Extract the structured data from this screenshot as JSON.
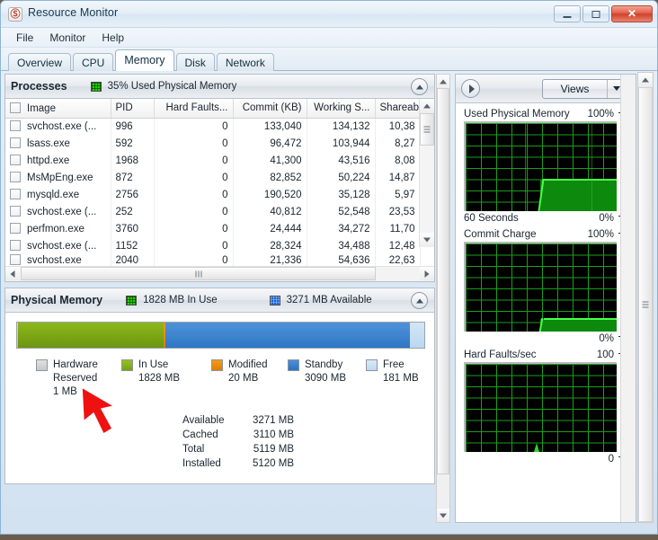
{
  "window": {
    "title": "Resource Monitor",
    "icon": "app-icon",
    "minimize_label": "",
    "maximize_label": "",
    "close_label": "✕"
  },
  "menu": {
    "items": [
      {
        "label": "File"
      },
      {
        "label": "Monitor"
      },
      {
        "label": "Help"
      }
    ]
  },
  "tabs": {
    "items": [
      {
        "label": "Overview",
        "active": false
      },
      {
        "label": "CPU",
        "active": false
      },
      {
        "label": "Memory",
        "active": true
      },
      {
        "label": "Disk",
        "active": false
      },
      {
        "label": "Network",
        "active": false
      }
    ]
  },
  "processes": {
    "title": "Processes",
    "header_stat": "35% Used Physical Memory",
    "columns": [
      "Image",
      "PID",
      "Hard Faults...",
      "Commit (KB)",
      "Working S...",
      "Shareable |"
    ],
    "rows": [
      {
        "image": "svchost.exe (...",
        "pid": "996",
        "hard_faults": "0",
        "commit": "133,040",
        "working_set": "134,132",
        "shareable": "10,38"
      },
      {
        "image": "lsass.exe",
        "pid": "592",
        "hard_faults": "0",
        "commit": "96,472",
        "working_set": "103,944",
        "shareable": "8,27"
      },
      {
        "image": "httpd.exe",
        "pid": "1968",
        "hard_faults": "0",
        "commit": "41,300",
        "working_set": "43,516",
        "shareable": "8,08"
      },
      {
        "image": "MsMpEng.exe",
        "pid": "872",
        "hard_faults": "0",
        "commit": "82,852",
        "working_set": "50,224",
        "shareable": "14,87"
      },
      {
        "image": "mysqld.exe",
        "pid": "2756",
        "hard_faults": "0",
        "commit": "190,520",
        "working_set": "35,128",
        "shareable": "5,97"
      },
      {
        "image": "svchost.exe (...",
        "pid": "252",
        "hard_faults": "0",
        "commit": "40,812",
        "working_set": "52,548",
        "shareable": "23,53"
      },
      {
        "image": "perfmon.exe",
        "pid": "3760",
        "hard_faults": "0",
        "commit": "24,444",
        "working_set": "34,272",
        "shareable": "11,70"
      },
      {
        "image": "svchost.exe (...",
        "pid": "1152",
        "hard_faults": "0",
        "commit": "28,324",
        "working_set": "34,488",
        "shareable": "12,48"
      },
      {
        "image": "svchost.exe",
        "pid": "2040",
        "hard_faults": "0",
        "commit": "21,336",
        "working_set": "54,636",
        "shareable": "22,63"
      }
    ]
  },
  "physical_memory": {
    "title": "Physical Memory",
    "in_use_stat": "1828 MB In Use",
    "available_stat": "3271 MB Available",
    "bar_segments": [
      {
        "name": "hardware-reserved",
        "color": "#cccccc",
        "percent": 0.02
      },
      {
        "name": "in-use",
        "color": "#7da915",
        "percent": 35.7
      },
      {
        "name": "modified",
        "color": "#e88606",
        "percent": 0.5
      },
      {
        "name": "standby",
        "color": "#3b83cd",
        "percent": 60.3
      },
      {
        "name": "free",
        "color": "#c6dff3",
        "percent": 3.5
      }
    ],
    "legend": [
      {
        "label_line1": "Hardware",
        "label_line2": "Reserved",
        "value": "1 MB",
        "color": "#cccccc"
      },
      {
        "label_line1": "In Use",
        "label_line2": "",
        "value": "1828 MB",
        "color": "#7da915"
      },
      {
        "label_line1": "Modified",
        "label_line2": "",
        "value": "20 MB",
        "color": "#e88606"
      },
      {
        "label_line1": "Standby",
        "label_line2": "",
        "value": "3090 MB",
        "color": "#3b83cd"
      },
      {
        "label_line1": "Free",
        "label_line2": "",
        "value": "181 MB",
        "color": "#c6dff3"
      }
    ],
    "stats": [
      {
        "key": "Available",
        "value": "3271 MB"
      },
      {
        "key": "Cached",
        "value": "3110 MB"
      },
      {
        "key": "Total",
        "value": "5119 MB"
      },
      {
        "key": "Installed",
        "value": "5120 MB"
      }
    ]
  },
  "views": {
    "label": "Views"
  },
  "chart_data": [
    {
      "type": "area",
      "title": "Used Physical Memory",
      "ymax_label": "100%",
      "ymin_label": "0%",
      "xlabel": "60 Seconds",
      "ylim": [
        0,
        100
      ],
      "grid": true,
      "series": [
        {
          "name": "Used Physical Memory",
          "values": [
            0,
            0,
            0,
            0,
            0,
            0,
            35,
            35,
            35,
            35,
            35,
            35
          ]
        }
      ],
      "color": "#0d8a0d"
    },
    {
      "type": "area",
      "title": "Commit Charge",
      "ymax_label": "100%",
      "ymin_label": "0%",
      "xlabel": "",
      "ylim": [
        0,
        100
      ],
      "grid": true,
      "series": [
        {
          "name": "Commit Charge",
          "values": [
            0,
            0,
            0,
            0,
            0,
            0,
            14,
            14,
            14,
            14,
            14,
            14
          ]
        }
      ],
      "color": "#0d8a0d"
    },
    {
      "type": "line",
      "title": "Hard Faults/sec",
      "ymax_label": "100",
      "ymin_label": "0",
      "xlabel": "",
      "ylim": [
        0,
        100
      ],
      "grid": true,
      "series": [
        {
          "name": "Hard Faults/sec",
          "values": [
            0,
            0,
            0,
            0,
            0,
            6,
            0,
            0,
            0,
            0,
            0,
            0
          ]
        }
      ],
      "color": "#0d8a0d"
    }
  ]
}
